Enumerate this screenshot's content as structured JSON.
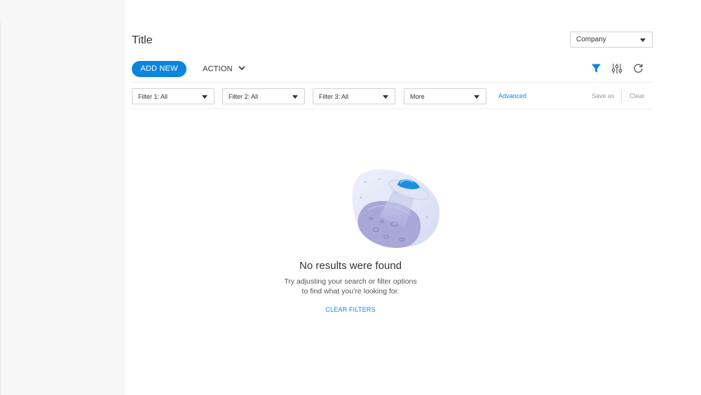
{
  "page": {
    "title": "Title",
    "company_select": {
      "value": "Company"
    }
  },
  "toolbar": {
    "add_new_label": "ADD NEW",
    "action_label": "ACTION",
    "icons": [
      "filter-icon",
      "settings-sliders-icon",
      "refresh-icon"
    ]
  },
  "filters": {
    "items": [
      {
        "label": "Filter 1: All"
      },
      {
        "label": "Filter 2: All"
      },
      {
        "label": "Filter 3: All"
      },
      {
        "label": "More"
      }
    ],
    "advanced_label": "Advanced",
    "save_as_label": "Save as",
    "clear_label": "Clear"
  },
  "empty_state": {
    "title": "No results were found",
    "hint_line1": "Try adjusting your search or filter options",
    "hint_line2": "to find what you’re looking for.",
    "clear_filters_label": "CLEAR FILTERS"
  },
  "colors": {
    "accent": "#0a85e0",
    "sidebar_bg": "#f7f7f8",
    "text": "#333333",
    "muted": "#999999"
  }
}
